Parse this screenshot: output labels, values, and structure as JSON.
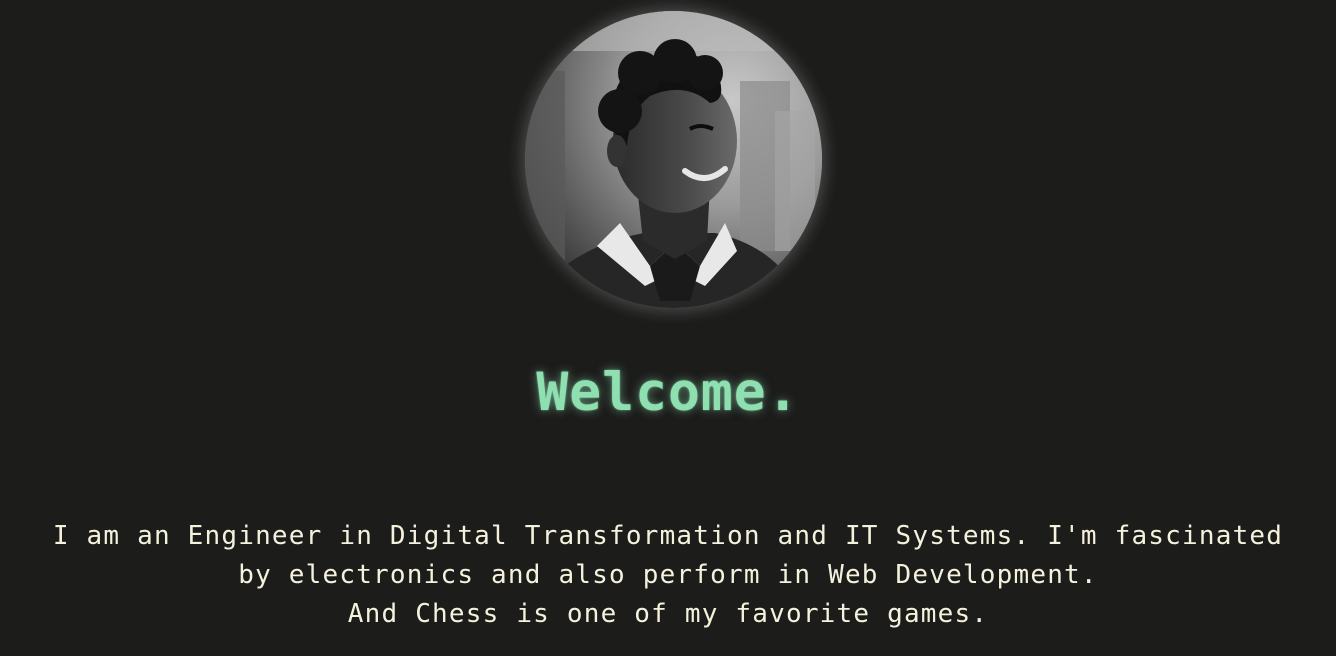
{
  "profile": {
    "photo_icon": "portrait-photo",
    "heading": "Welcome.",
    "bio_lines": [
      "I am an Engineer in Digital Transformation and IT Systems. I'm fascinated",
      "by electronics and also perform in Web Development.",
      "And Chess is one of my favorite games."
    ]
  },
  "colors": {
    "background": "#1c1c1b",
    "accent": "#8fe0b0",
    "text": "#f4f1dc"
  }
}
